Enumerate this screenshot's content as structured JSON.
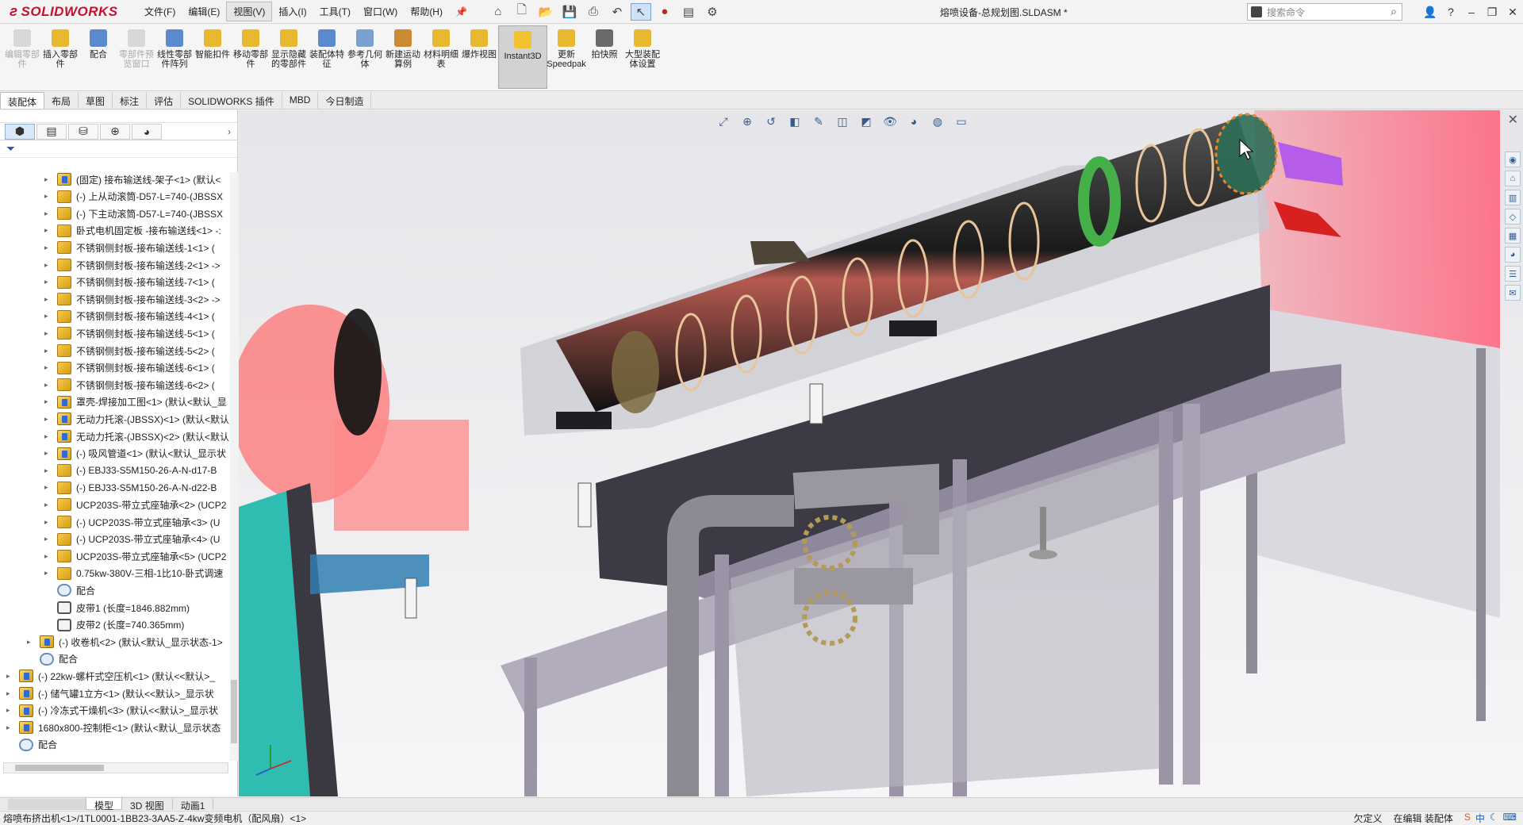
{
  "app": {
    "logo_text": "SOLIDWORKS",
    "doc_title": "熔喷设备-总规划图.SLDASM *"
  },
  "menu": [
    "文件(F)",
    "编辑(E)",
    "视图(V)",
    "插入(I)",
    "工具(T)",
    "窗口(W)",
    "帮助(H)"
  ],
  "search": {
    "placeholder": "搜索命令"
  },
  "ribbon": [
    {
      "label": "编辑零部件",
      "disabled": true
    },
    {
      "label": "插入零部件",
      "disabled": false
    },
    {
      "label": "配合",
      "disabled": false
    },
    {
      "label": "零部件预览窗口",
      "disabled": true
    },
    {
      "label": "线性零部件阵列",
      "disabled": false
    },
    {
      "label": "智能扣件",
      "disabled": false
    },
    {
      "label": "移动零部件",
      "disabled": false
    },
    {
      "label": "显示隐藏的零部件",
      "disabled": false
    },
    {
      "label": "装配体特征",
      "disabled": false
    },
    {
      "label": "参考几何体",
      "disabled": false
    },
    {
      "label": "新建运动算例",
      "disabled": false
    },
    {
      "label": "材料明细表",
      "disabled": false
    },
    {
      "label": "爆炸视图",
      "disabled": false
    },
    {
      "label": "Instant3D",
      "disabled": false,
      "active": true
    },
    {
      "label": "更新Speedpak",
      "disabled": false
    },
    {
      "label": "拍快照",
      "disabled": false
    },
    {
      "label": "大型装配体设置",
      "disabled": false
    }
  ],
  "tabs": [
    "装配体",
    "布局",
    "草图",
    "标注",
    "评估",
    "SOLIDWORKS 插件",
    "MBD",
    "今日制造"
  ],
  "tree": [
    {
      "label": "(固定) 接布输送线-架子<1> (默认<",
      "icon": "asm",
      "indent": 1
    },
    {
      "label": "(-) 上从动滚筒-D57-L=740-(JBSSX",
      "icon": "part",
      "indent": 1
    },
    {
      "label": "(-) 下主动滚筒-D57-L=740-(JBSSX",
      "icon": "part",
      "indent": 1
    },
    {
      "label": "卧式电机固定板 -接布输送线<1> -:",
      "icon": "part",
      "indent": 1
    },
    {
      "label": "不锈钢侧封板-接布输送线-1<1> (",
      "icon": "part",
      "indent": 1
    },
    {
      "label": "不锈钢侧封板-接布输送线-2<1> ->",
      "icon": "part",
      "indent": 1
    },
    {
      "label": "不锈钢侧封板-接布输送线-7<1> (",
      "icon": "part",
      "indent": 1
    },
    {
      "label": "不锈钢侧封板-接布输送线-3<2> ->",
      "icon": "part",
      "indent": 1
    },
    {
      "label": "不锈钢侧封板-接布输送线-4<1> (",
      "icon": "part",
      "indent": 1
    },
    {
      "label": "不锈钢侧封板-接布输送线-5<1> (",
      "icon": "part",
      "indent": 1
    },
    {
      "label": "不锈钢侧封板-接布输送线-5<2> (",
      "icon": "part",
      "indent": 1
    },
    {
      "label": "不锈钢侧封板-接布输送线-6<1> (",
      "icon": "part",
      "indent": 1
    },
    {
      "label": "不锈钢侧封板-接布输送线-6<2> (",
      "icon": "part",
      "indent": 1
    },
    {
      "label": "罩壳-焊接加工图<1> (默认<默认_显",
      "icon": "asm",
      "indent": 1
    },
    {
      "label": "无动力托滚-(JBSSX)<1> (默认<默认",
      "icon": "asm",
      "indent": 1
    },
    {
      "label": "无动力托滚-(JBSSX)<2> (默认<默认",
      "icon": "asm",
      "indent": 1
    },
    {
      "label": "(-) 吸风管道<1> (默认<默认_显示状",
      "icon": "asm",
      "indent": 1
    },
    {
      "label": "(-) EBJ33-S5M150-26-A-N-d17-B",
      "icon": "part",
      "indent": 1
    },
    {
      "label": "(-) EBJ33-S5M150-26-A-N-d22-B",
      "icon": "part",
      "indent": 1
    },
    {
      "label": "UCP203S-带立式座轴承<2> (UCP2",
      "icon": "part",
      "indent": 1
    },
    {
      "label": "(-) UCP203S-带立式座轴承<3> (U",
      "icon": "part",
      "indent": 1
    },
    {
      "label": "(-) UCP203S-带立式座轴承<4> (U",
      "icon": "part",
      "indent": 1
    },
    {
      "label": "UCP203S-带立式座轴承<5> (UCP2",
      "icon": "part",
      "indent": 1
    },
    {
      "label": "0.75kw-380V-三相-1比10-卧式调速",
      "icon": "part",
      "indent": 1
    },
    {
      "label": "配合",
      "icon": "mate",
      "indent": 1
    },
    {
      "label": "皮带1 (长度=1846.882mm)",
      "icon": "belt",
      "indent": 1
    },
    {
      "label": "皮带2 (长度=740.365mm)",
      "icon": "belt",
      "indent": 1
    },
    {
      "label": "(-) 收卷机<2> (默认<默认_显示状态-1>",
      "icon": "asm",
      "indent": 0
    },
    {
      "label": "配合",
      "icon": "mate",
      "indent": 0
    },
    {
      "label": "(-) 22kw-螺杆式空压机<1> (默认<<默认>_",
      "icon": "asm",
      "indent": -1
    },
    {
      "label": "(-) 储气罐1立方<1> (默认<<默认>_显示状",
      "icon": "asm",
      "indent": -1
    },
    {
      "label": "(-) 冷冻式干燥机<3> (默认<<默认>_显示状",
      "icon": "asm",
      "indent": -1
    },
    {
      "label": "1680x800-控制柜<1> (默认<默认_显示状态",
      "icon": "asm",
      "indent": -1
    },
    {
      "label": "配合",
      "icon": "mate",
      "indent": -1
    }
  ],
  "bottom_tabs": [
    "模型",
    "3D 视图",
    "动画1"
  ],
  "status": {
    "left": "熔喷布挤出机<1>/1TL0001-1BB23-3AA5-Z-4kw变频电机（配风扇）<1>",
    "custom": "欠定义",
    "editing": "在编辑 装配体",
    "ime": "中"
  },
  "colors": {
    "accent": "#c8102e",
    "shaft": "#2a2a2a",
    "frame": "#a9a3b4",
    "red_part": "#ff5a5a",
    "green_ring": "#45b04a",
    "purple_part": "#b55ce8"
  }
}
